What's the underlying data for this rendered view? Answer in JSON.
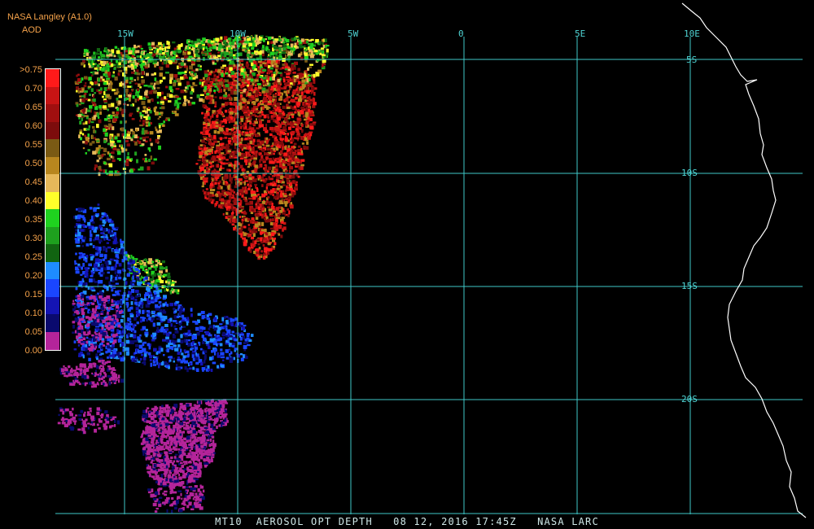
{
  "header": {
    "title": "NASA Langley (A1.0)",
    "parameter": "AOD"
  },
  "longitude_labels": [
    "15W",
    "10W",
    "5W",
    "0",
    "5E",
    "10E"
  ],
  "latitude_labels": [
    "5S",
    "10S",
    "15S",
    "20S"
  ],
  "legend": {
    "ticks": [
      ">0.75",
      "0.70",
      "0.65",
      "0.60",
      "0.55",
      "0.50",
      "0.45",
      "0.40",
      "0.35",
      "0.30",
      "0.25",
      "0.20",
      "0.15",
      "0.10",
      "0.05",
      "0.00"
    ],
    "colors": [
      "#ff1a1a",
      "#c81414",
      "#a00f0f",
      "#7c0c0c",
      "#7a5a14",
      "#b8861e",
      "#e6b85a",
      "#ffff2a",
      "#1fd21f",
      "#1ea01e",
      "#116411",
      "#1e8cff",
      "#1a46ff",
      "#1414b4",
      "#0a0a6e",
      "#b4249a"
    ]
  },
  "caption": "MT10  AEROSOL OPT DEPTH   08 12, 2016 17:45Z   NASA LARC"
}
